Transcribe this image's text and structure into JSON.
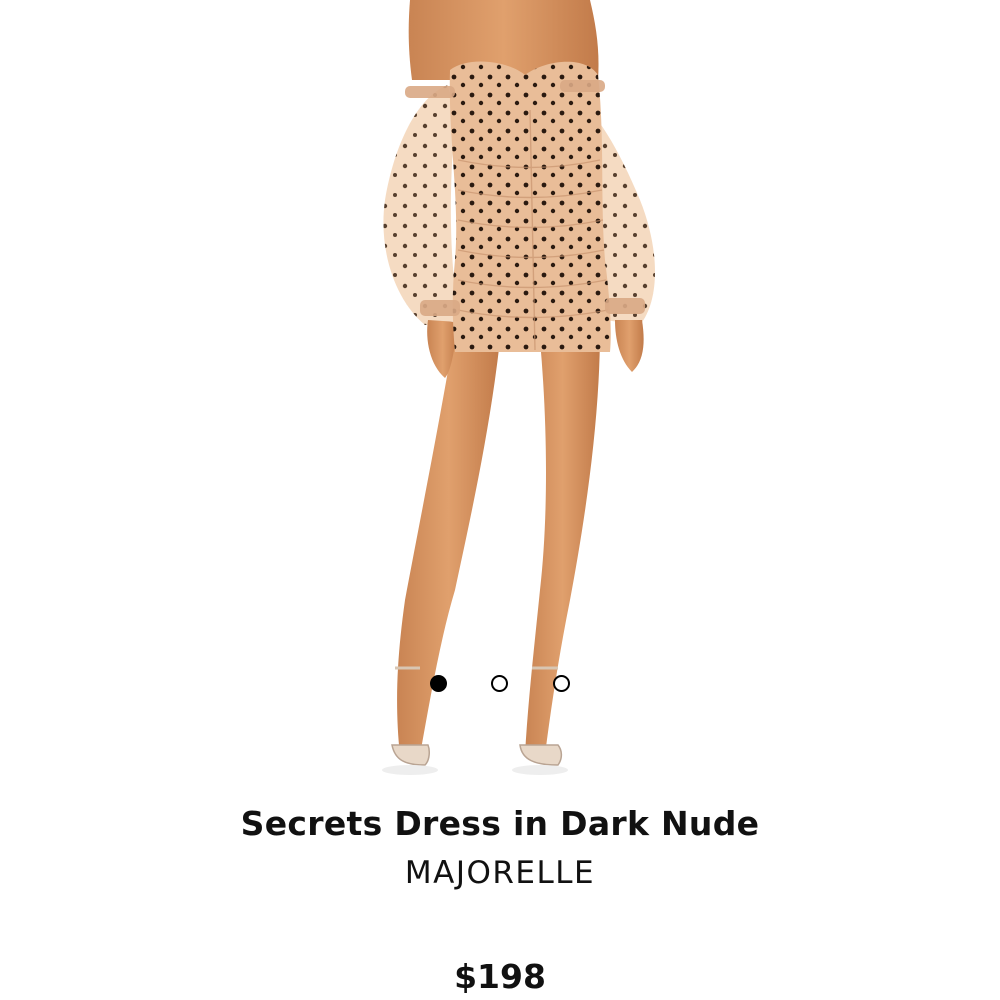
{
  "product": {
    "title": "Secrets Dress in Dark Nude",
    "brand": "MAJORELLE",
    "price": "$198"
  },
  "gallery": {
    "image_count": 3,
    "active_index": 0
  },
  "colors": {
    "dress": "#e7b68f",
    "dots": "#2a1a10",
    "skin": "#d9935f",
    "text": "#111111"
  }
}
